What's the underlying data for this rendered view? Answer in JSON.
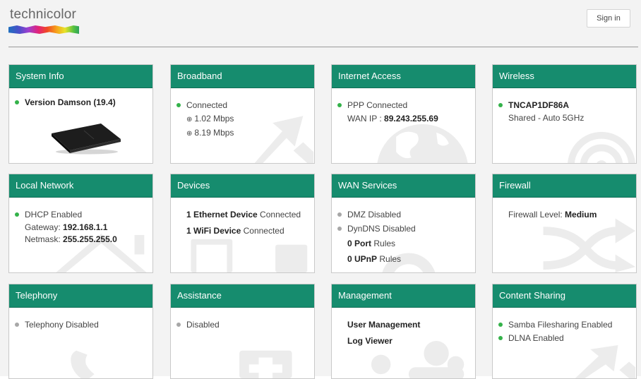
{
  "header": {
    "logo": "technicolor",
    "signin_label": "Sign in"
  },
  "colors": {
    "accent": "#168c6e",
    "status_ok": "#34b24a",
    "status_off": "#a7a7a7"
  },
  "cards": {
    "system_info": {
      "title": "System Info",
      "version": "Version Damson (19.4)"
    },
    "broadband": {
      "title": "Broadband",
      "status": "Connected",
      "upload": "1.02 Mbps",
      "download": "8.19 Mbps"
    },
    "internet_access": {
      "title": "Internet Access",
      "status": "PPP Connected",
      "wan_ip_label": "WAN IP : ",
      "wan_ip": "89.243.255.69"
    },
    "wireless": {
      "title": "Wireless",
      "ssid": "TNCAP1DF86A",
      "mode": "Shared - Auto 5GHz"
    },
    "local_network": {
      "title": "Local Network",
      "dhcp": "DHCP Enabled",
      "gateway_label": "Gateway: ",
      "gateway": "192.168.1.1",
      "netmask_label": "Netmask: ",
      "netmask": "255.255.255.0"
    },
    "devices": {
      "title": "Devices",
      "ethernet_count": "1 Ethernet Device",
      "ethernet_suffix": " Connected",
      "wifi_count": "1 WiFi Device",
      "wifi_suffix": " Connected"
    },
    "wan_services": {
      "title": "WAN Services",
      "dmz": "DMZ Disabled",
      "dyndns": "DynDNS Disabled",
      "port_count": "0 Port",
      "port_suffix": " Rules",
      "upnp_count": "0 UPnP",
      "upnp_suffix": " Rules"
    },
    "firewall": {
      "title": "Firewall",
      "level_label": "Firewall Level: ",
      "level": "Medium"
    },
    "telephony": {
      "title": "Telephony",
      "status": "Telephony Disabled"
    },
    "assistance": {
      "title": "Assistance",
      "status": "Disabled"
    },
    "management": {
      "title": "Management",
      "user_management": "User Management",
      "log_viewer": "Log Viewer"
    },
    "content_sharing": {
      "title": "Content Sharing",
      "samba": "Samba Filesharing Enabled",
      "dlna": "DLNA Enabled"
    }
  }
}
